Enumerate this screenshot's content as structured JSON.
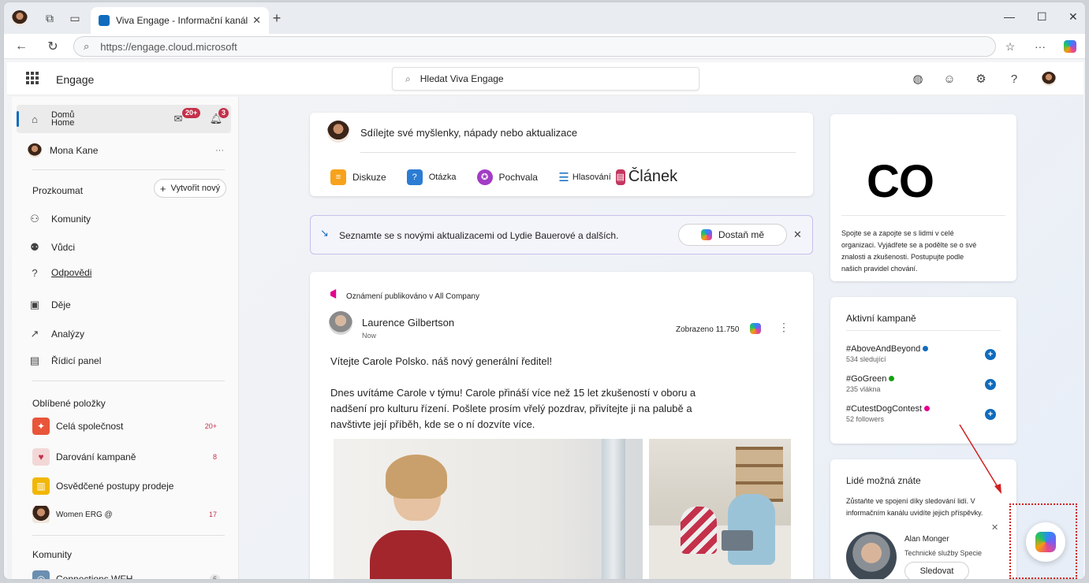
{
  "browser": {
    "tab_title": "Viva Engage - Informační kanál",
    "url": "https://engage.cloud.microsoft"
  },
  "header": {
    "brand": "Engage",
    "search_placeholder": "Hledat Viva Engage"
  },
  "sidebar": {
    "home_label_primary": "Domů",
    "home_label_secondary": "Home",
    "messages_badge": "20+",
    "notifications_badge": "3",
    "user_name": "Mona Kane",
    "user_more": "···",
    "explore_label": "Prozkoumat",
    "create_button": "Vytvořit nový",
    "items": [
      {
        "label": "Komunity",
        "icon": "communities-icon"
      },
      {
        "label": "Vůdci",
        "icon": "leaders-icon"
      },
      {
        "label": "Odpovědi",
        "icon": "answers-icon"
      },
      {
        "label": "Děje",
        "icon": "events-icon"
      },
      {
        "label": "Analýzy",
        "icon": "analytics-icon"
      },
      {
        "label": "Řídicí panel",
        "icon": "dashboard-icon"
      }
    ],
    "favorites_label": "Oblíbené položky",
    "favorites": [
      {
        "label": "Celá společnost",
        "count": "20+",
        "color": "#e8553a"
      },
      {
        "label": "Darování kampaně",
        "count": "8",
        "color": "#f3d7d7"
      },
      {
        "label": "Osvědčené postupy prodeje",
        "count": "",
        "color": "#f2b705"
      },
      {
        "label": "Women ERG @",
        "count": "17",
        "color": "#c9a58a"
      }
    ],
    "communities_label": "Komunity",
    "communities": [
      {
        "label": "Connections WFH",
        "count": "6"
      }
    ]
  },
  "composer": {
    "prompt": "Sdílejte své myšlenky, nápady nebo aktualizace",
    "actions": [
      {
        "label": "Diskuze",
        "color": "#f7a21b"
      },
      {
        "label": "Otázka",
        "color": "#2b7cd3"
      },
      {
        "label": "Pochvala",
        "color": "#a23cc4"
      },
      {
        "label": "Hlasování",
        "color": "#0f6cbd"
      },
      {
        "label": "Článek",
        "color": "#c43760"
      }
    ]
  },
  "banner": {
    "text": "Seznamte se s novými aktualizacemi od Lydie Bauerové a dalších.",
    "button": "Dostaň mě",
    "close": "✕"
  },
  "post": {
    "announcement": "Oznámení publikováno v All Company",
    "author": "Laurence Gilbertson",
    "time": "Now",
    "views": "Zobrazeno 11.750",
    "headline": "Vítejte Carole Polsko. náš nový generální ředitel!",
    "body": "Dnes uvítáme Carole v týmu! Carole přináší více než 15 let zkušeností v oboru a nadšení pro kulturu řízení. Pošlete prosím vřelý pozdrav, přivítejte ji na palubě a navštivte její příběh, kde se o ní dozvíte více."
  },
  "right": {
    "org_logo_text": "CO",
    "org_text": "Spojte se a zapojte se s lidmi v celé organizaci. Vyjádřete se a podělte se o své znalosti a zkušenosti. Postupujte podle našich pravidel chování.",
    "campaigns_title": "Aktivní kampaně",
    "campaigns": [
      {
        "name": "#AboveAndBeyond",
        "sub": "534 sledující",
        "dot": "#0f6cbd"
      },
      {
        "name": "#GoGreen",
        "sub": "235 vlákna",
        "dot": "#13a10e"
      },
      {
        "name": "#CutestDogContest",
        "sub": "52 followers",
        "dot": "#e3008c"
      }
    ],
    "people_title": "Lidé možná znáte",
    "people_text": "Zůstaňte ve spojení díky sledování lidí. V informačním kanálu uvidíte jejich příspěvky.",
    "person_name": "Alan Monger",
    "person_title": "Technické služby Specie",
    "follow_button": "Sledovat",
    "close": "✕"
  }
}
